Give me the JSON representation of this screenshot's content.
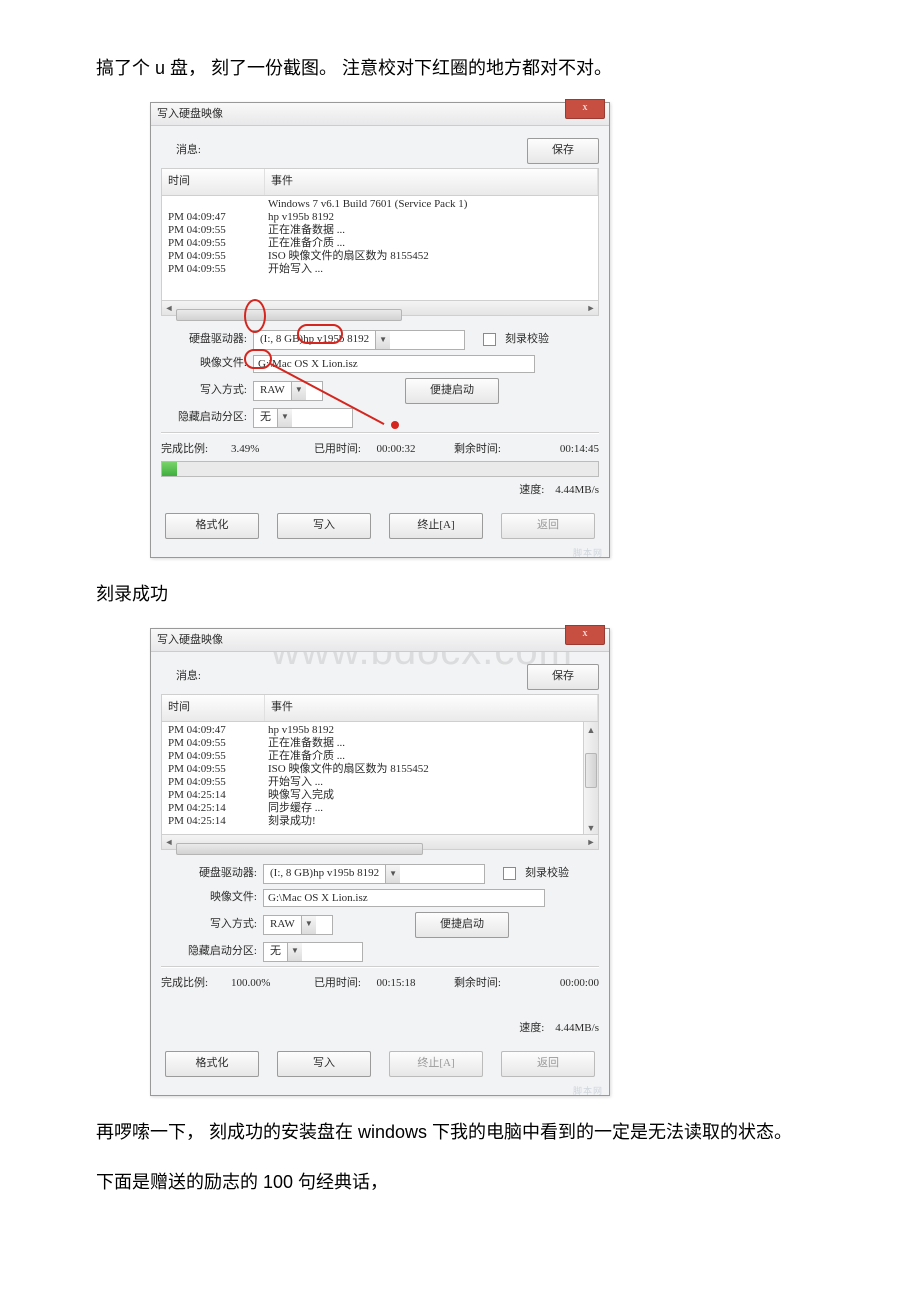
{
  "doc": {
    "p1": "搞了个 u 盘， 刻了一份截图。 注意校对下红圈的地方都对不对。",
    "p2": "刻录成功",
    "p3": "再啰嗦一下， 刻成功的安装盘在 windows 下我的电脑中看到的一定是无法读取的状态。",
    "p4": "下面是赠送的励志的 100 句经典话，"
  },
  "d1": {
    "title": "写入硬盘映像",
    "close": "x",
    "msg_label": "消息:",
    "save": "保存",
    "col_time": "时间",
    "col_event": "事件",
    "log": [
      {
        "t": "",
        "e": "Windows 7 v6.1 Build 7601 (Service Pack 1)"
      },
      {
        "t": "PM 04:09:47",
        "e": "hp       v195b             8192"
      },
      {
        "t": "PM 04:09:55",
        "e": "正在准备数据 ..."
      },
      {
        "t": "PM 04:09:55",
        "e": "正在准备介质 ..."
      },
      {
        "t": "PM 04:09:55",
        "e": "ISO 映像文件的扇区数为 8155452"
      },
      {
        "t": "PM 04:09:55",
        "e": "开始写入 ..."
      }
    ],
    "drive_label": "硬盘驱动器:",
    "drive_value": "(I:, 8 GB)hp        v195b             8192",
    "verify_label": "刻录校验",
    "image_label": "映像文件:",
    "image_value": "G:\\Mac OS X Lion.isz",
    "mode_label": "写入方式:",
    "mode_value": "RAW",
    "boot_btn": "便捷启动",
    "hide_label": "隐藏启动分区:",
    "hide_value": "无",
    "done_label": "完成比例:",
    "done_value": "3.49%",
    "elapsed_label": "已用时间:",
    "elapsed_value": "00:00:32",
    "remain_label": "剩余时间:",
    "remain_value": "00:14:45",
    "speed_label": "速度:",
    "speed_value": "4.44MB/s",
    "btn_format": "格式化",
    "btn_write": "写入",
    "btn_stop": "终止[A]",
    "btn_back": "返回",
    "progress_pct": 3.5
  },
  "d2": {
    "title": "写入硬盘映像",
    "close": "x",
    "msg_label": "消息:",
    "save": "保存",
    "col_time": "时间",
    "col_event": "事件",
    "log": [
      {
        "t": "PM 04:09:47",
        "e": "hp       v195b             8192"
      },
      {
        "t": "PM 04:09:55",
        "e": "正在准备数据 ..."
      },
      {
        "t": "PM 04:09:55",
        "e": "正在准备介质 ..."
      },
      {
        "t": "PM 04:09:55",
        "e": "ISO 映像文件的扇区数为 8155452"
      },
      {
        "t": "PM 04:09:55",
        "e": "开始写入 ..."
      },
      {
        "t": "PM 04:25:14",
        "e": "映像写入完成"
      },
      {
        "t": "PM 04:25:14",
        "e": "同步缓存 ..."
      },
      {
        "t": "PM 04:25:14",
        "e": "刻录成功!"
      }
    ],
    "drive_label": "硬盘驱动器:",
    "drive_value": "(I:, 8 GB)hp        v195b             8192",
    "verify_label": "刻录校验",
    "image_label": "映像文件:",
    "image_value": "G:\\Mac OS X Lion.isz",
    "mode_label": "写入方式:",
    "mode_value": "RAW",
    "boot_btn": "便捷启动",
    "hide_label": "隐藏启动分区:",
    "hide_value": "无",
    "done_label": "完成比例:",
    "done_value": "100.00%",
    "elapsed_label": "已用时间:",
    "elapsed_value": "00:15:18",
    "remain_label": "剩余时间:",
    "remain_value": "00:00:00",
    "speed_label": "速度:",
    "speed_value": "4.44MB/s",
    "btn_format": "格式化",
    "btn_write": "写入",
    "btn_stop": "终止[A]",
    "btn_back": "返回",
    "progress_pct": 100
  },
  "watermark_site": "www.bdocx.com"
}
